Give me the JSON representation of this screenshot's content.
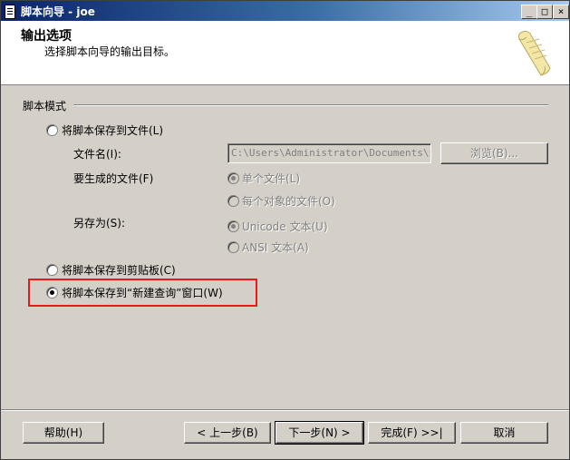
{
  "window": {
    "title": "脚本向导 - joe"
  },
  "titlebar_buttons": {
    "minimize": "_",
    "maximize": "□",
    "close": "×"
  },
  "header": {
    "title": "输出选项",
    "subtitle": "选择脚本向导的输出目标。"
  },
  "script_mode": {
    "group_label": "脚本模式",
    "save_to_file": {
      "label": "将脚本保存到文件(L)",
      "checked": false
    },
    "file_name_label": "文件名(I):",
    "file_name_value": "C:\\Users\\Administrator\\Documents\\scri",
    "browse_button": "浏览(B)...",
    "files_to_generate_label": "要生成的文件(F)",
    "single_file": {
      "label": "单个文件(L)",
      "checked": true
    },
    "file_per_object": {
      "label": "每个对象的文件(O)",
      "checked": false
    },
    "save_as_label": "另存为(S):",
    "unicode_text": {
      "label": "Unicode 文本(U)",
      "checked": true
    },
    "ansi_text": {
      "label": "ANSI 文本(A)",
      "checked": false
    },
    "save_to_clipboard": {
      "label": "将脚本保存到剪贴板(C)",
      "checked": false
    },
    "save_to_new_query": {
      "label": "将脚本保存到“新建查询”窗口(W)",
      "checked": true
    }
  },
  "footer": {
    "help": "帮助(H)",
    "back": "< 上一步(B)",
    "next": "下一步(N) >",
    "finish": "完成(F) >>|",
    "cancel": "取消"
  },
  "colors": {
    "titlebar_start": "#0a246a",
    "titlebar_end": "#a6caf0",
    "highlight_box": "#e8181b",
    "dialog_face": "#d4d0c8"
  },
  "icons": {
    "app": "document-icon",
    "header_graphic": "scroll-icon"
  }
}
